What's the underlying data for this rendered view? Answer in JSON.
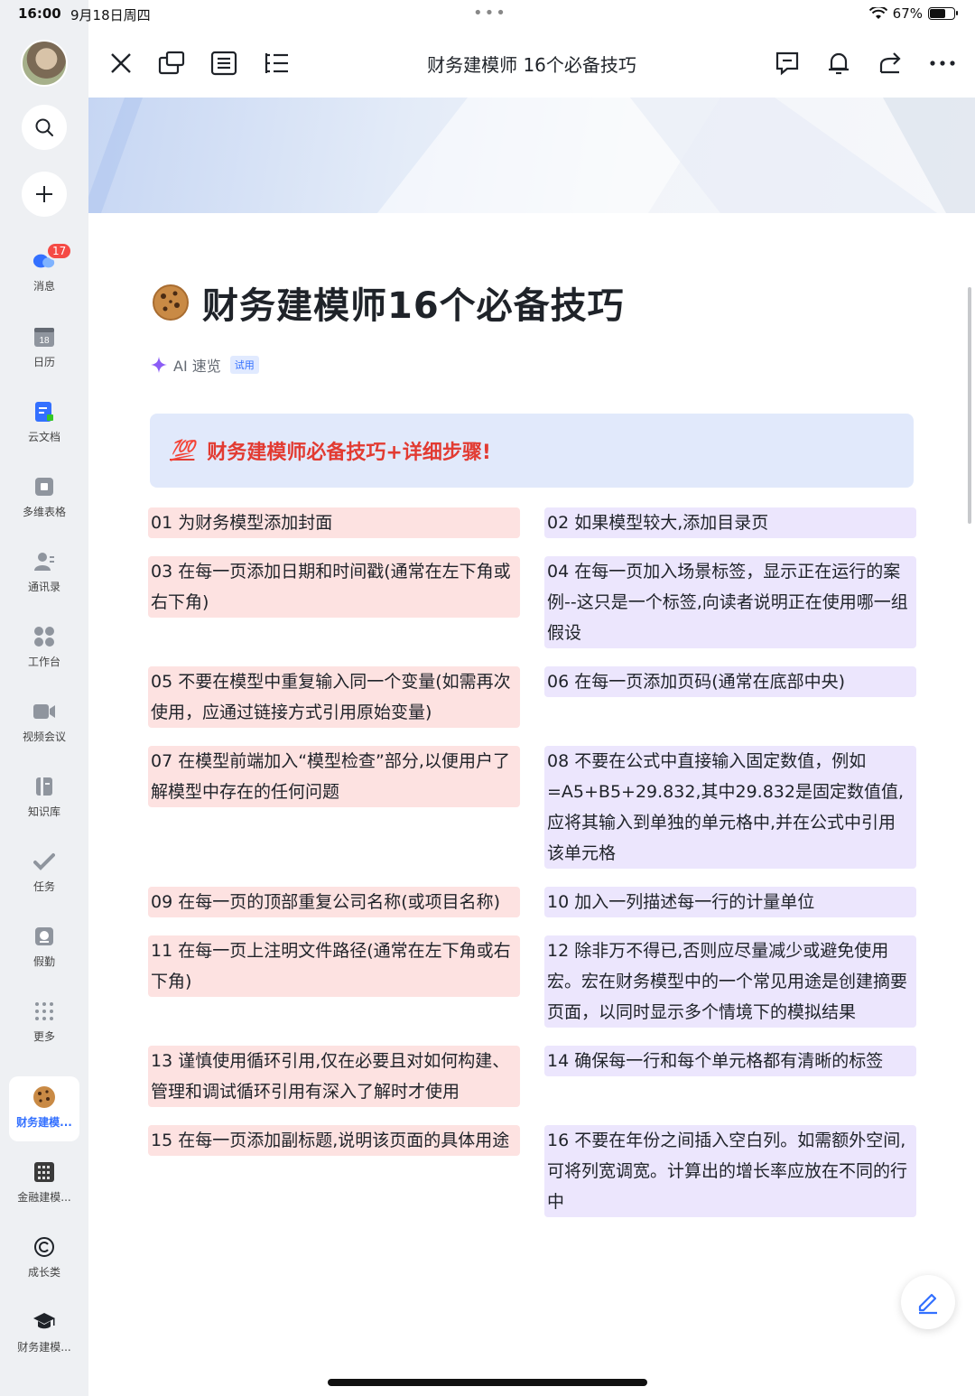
{
  "status": {
    "time": "16:00",
    "date": "9月18日周四",
    "battery": "67%",
    "battery_level": 0.67
  },
  "sidebar": {
    "badge": "17",
    "items": [
      {
        "label": "消息",
        "icon": "chat-bubbles-icon"
      },
      {
        "label": "日历",
        "icon": "calendar-icon",
        "icon_text": "18"
      },
      {
        "label": "云文档",
        "icon": "doc-icon"
      },
      {
        "label": "多维表格",
        "icon": "table-icon"
      },
      {
        "label": "通讯录",
        "icon": "contacts-icon"
      },
      {
        "label": "工作台",
        "icon": "apps-grid-icon"
      },
      {
        "label": "视频会议",
        "icon": "video-icon"
      },
      {
        "label": "知识库",
        "icon": "wiki-icon"
      },
      {
        "label": "任务",
        "icon": "task-check-icon"
      },
      {
        "label": "假勤",
        "icon": "attendance-icon"
      },
      {
        "label": "更多",
        "icon": "more-dots-icon"
      },
      {
        "label": "财务建模...",
        "icon": "cookie-icon",
        "active": true
      },
      {
        "label": "金融建模...",
        "icon": "abacus-icon"
      },
      {
        "label": "成长类",
        "icon": "copyright-icon"
      },
      {
        "label": "财务建模...",
        "icon": "graduation-cap-icon"
      }
    ]
  },
  "toolbar": {
    "title": "财务建模师 16个必备技巧"
  },
  "doc": {
    "title": "财务建模师16个必备技巧",
    "ai_label": "AI 速览",
    "ai_tag": "试用",
    "callout_emoji": "💯",
    "callout_text": "财务建模师必备技巧+详细步骤!"
  },
  "tips": [
    "01 为财务模型添加封面",
    "02 如果模型较大,添加目录页",
    "03 在每一页添加日期和时间戳(通常在左下角或右下角)",
    "04 在每一页加入场景标签，显示正在运行的案例--这只是一个标签,向读者说明正在使用哪一组假设",
    "05 不要在模型中重复输入同一个变量(如需再次使用，应通过链接方式引用原始变量)",
    "06 在每一页添加页码(通常在底部中央)",
    "07 在模型前端加入“模型检查”部分,以便用户了解模型中存在的任何问题",
    "08 不要在公式中直接输入固定数值，例如 =A5+B5+29.832,其中29.832是固定数值值,应将其输入到单独的单元格中,并在公式中引用该单元格",
    "09 在每一页的顶部重复公司名称(或项目名称)",
    "10 加入一列描述每一行的计量单位",
    "11 在每一页上注明文件路径(通常在左下角或右下角)",
    "12 除非万不得已,否则应尽量减少或避免使用宏。宏在财务模型中的一个常见用途是创建摘要页面，以同时显示多个情境下的模拟结果",
    "13 谨慎使用循环引用,仅在必要且对如何构建、管理和调试循环引用有深入了解时才使用",
    "14 确保每一行和每个单元格都有清晰的标签",
    "15 在每一页添加副标题,说明该页面的具体用途",
    "16 不要在年份之间插入空白列。如需额外空间,可将列宽调宽。计算出的增长率应放在不同的行中"
  ],
  "colors": {
    "pink": "#fde2e1",
    "purple": "#ece6fd",
    "accent": "#3370ff",
    "callout_bg": "#e1e9fb",
    "callout_text": "#e23b32"
  }
}
